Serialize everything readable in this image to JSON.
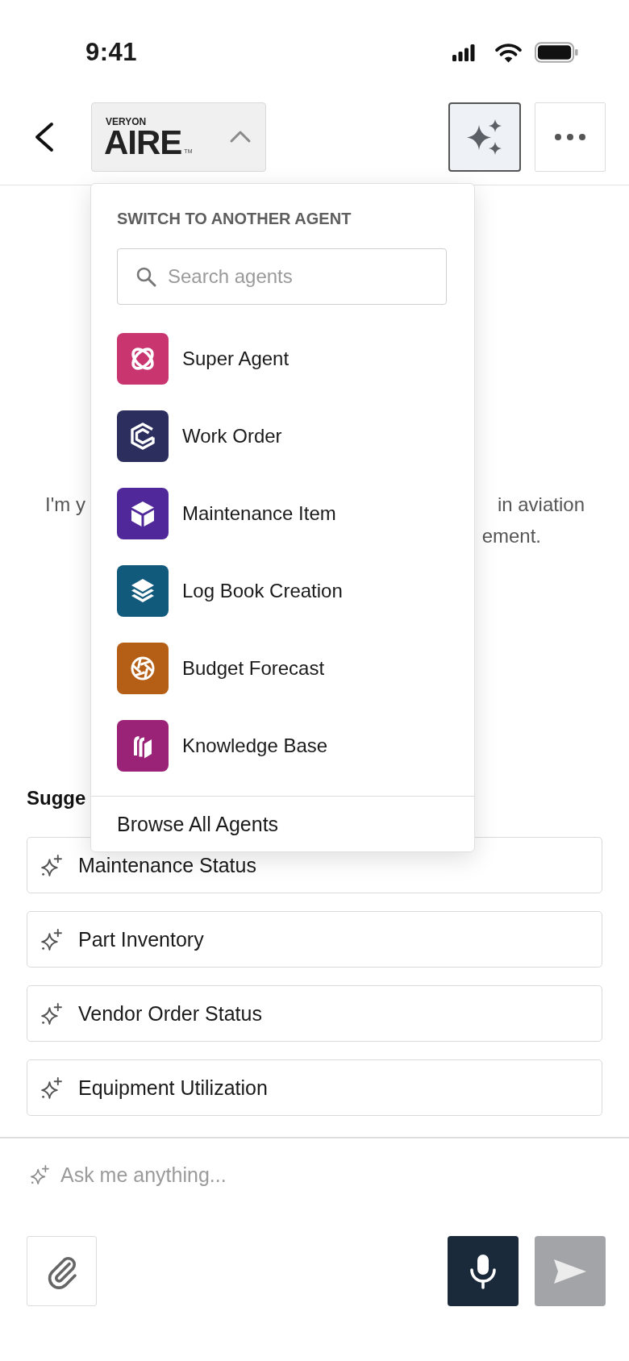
{
  "status_bar": {
    "time": "9:41"
  },
  "header": {
    "agent_switcher": {
      "brand": "VERYON",
      "logo": "AIRE",
      "trademark": "TM",
      "expanded": true
    },
    "assistant_button": {
      "active": true
    }
  },
  "agent_menu": {
    "title": "SWITCH TO ANOTHER AGENT",
    "search": {
      "placeholder": "Search agents"
    },
    "agents": [
      {
        "name": "Super Agent",
        "color": "#c8356f"
      },
      {
        "name": "Work Order",
        "color": "#2c2e5e"
      },
      {
        "name": "Maintenance Item",
        "color": "#50289a"
      },
      {
        "name": "Log Book Creation",
        "color": "#125a7c"
      },
      {
        "name": "Budget Forecast",
        "color": "#b55e16"
      },
      {
        "name": "Knowledge Base",
        "color": "#9a2377"
      }
    ],
    "footer_link": "Browse All Agents"
  },
  "welcome": {
    "lines": [
      {
        "left": "I'm y",
        "right": "in aviation"
      },
      {
        "right": "ement."
      }
    ]
  },
  "suggestions": {
    "title": "Sugge",
    "items": [
      {
        "label": "Maintenance Status"
      },
      {
        "label": "Part Inventory"
      },
      {
        "label": "Vendor Order Status"
      },
      {
        "label": "Equipment Utilization"
      }
    ]
  },
  "composer": {
    "placeholder": "Ask me anything...",
    "send_disabled": true
  }
}
